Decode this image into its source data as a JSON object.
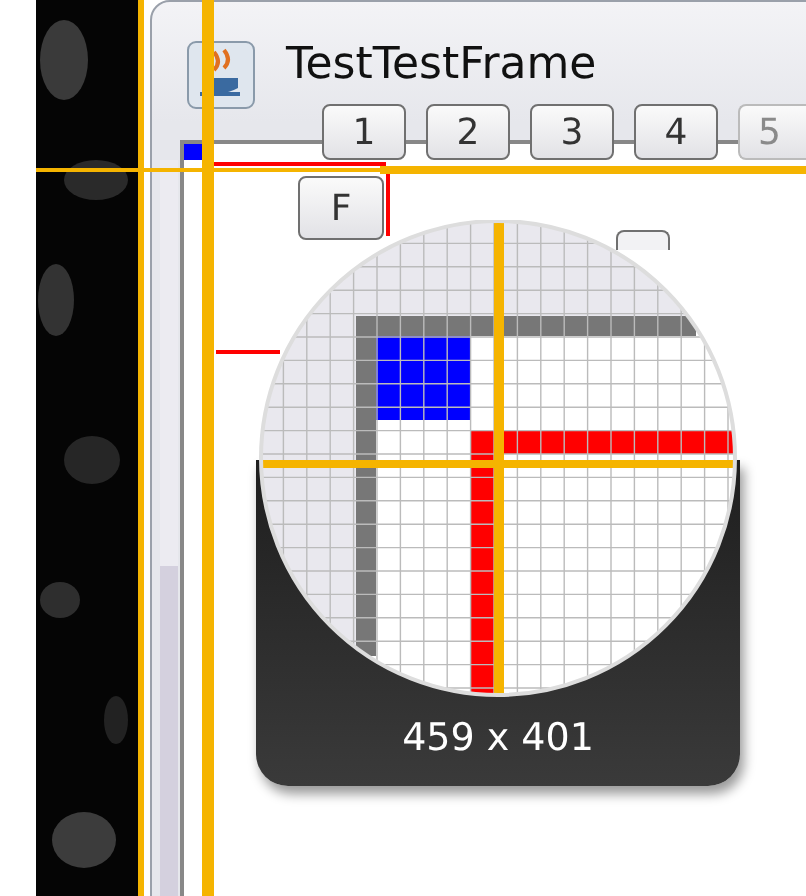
{
  "window": {
    "title": "TestTestFrame"
  },
  "number_buttons": [
    {
      "label": "1",
      "disabled": false
    },
    {
      "label": "2",
      "disabled": false
    },
    {
      "label": "3",
      "disabled": false
    },
    {
      "label": "4",
      "disabled": false
    },
    {
      "label": "5",
      "disabled": true
    }
  ],
  "f_button": {
    "label": "F"
  },
  "magnifier": {
    "reading": "459 x 401"
  }
}
